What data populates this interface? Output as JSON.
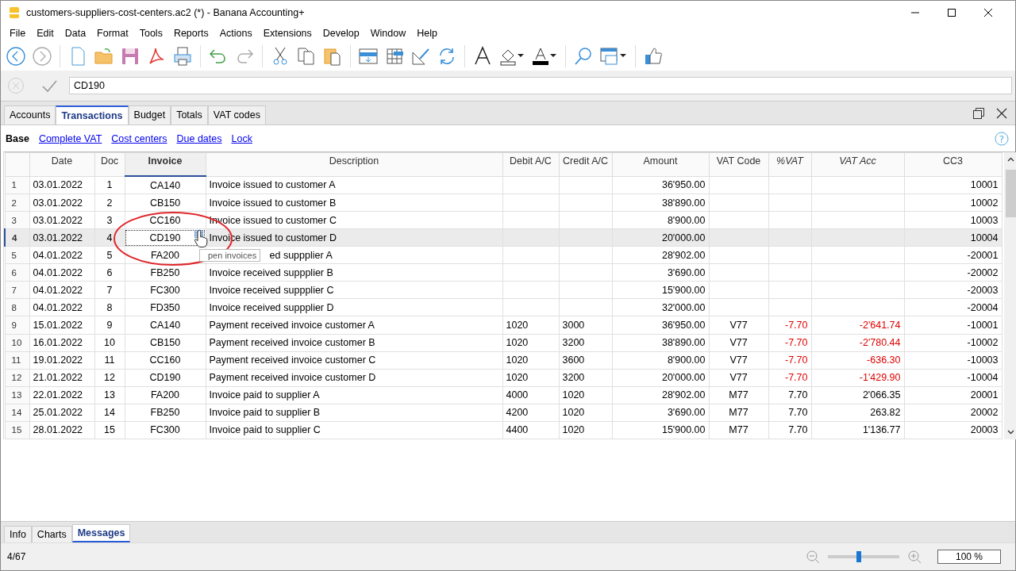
{
  "window": {
    "title": "customers-suppliers-cost-centers.ac2 (*) - Banana Accounting+"
  },
  "menu": [
    "File",
    "Edit",
    "Data",
    "Format",
    "Tools",
    "Reports",
    "Actions",
    "Extensions",
    "Develop",
    "Window",
    "Help"
  ],
  "edit_bar": {
    "value": "CD190"
  },
  "tabs": [
    {
      "label": "Accounts",
      "selected": false
    },
    {
      "label": "Transactions",
      "selected": true
    },
    {
      "label": "Budget",
      "selected": false
    },
    {
      "label": "Totals",
      "selected": false
    },
    {
      "label": "VAT codes",
      "selected": false
    }
  ],
  "views": [
    {
      "label": "Base",
      "selected": true
    },
    {
      "label": "Complete VAT",
      "selected": false
    },
    {
      "label": "Cost centers",
      "selected": false
    },
    {
      "label": "Due dates",
      "selected": false
    },
    {
      "label": "Lock",
      "selected": false
    }
  ],
  "help_button": {
    "symbol": "?"
  },
  "table": {
    "columns": [
      {
        "label": "Date",
        "selected": false
      },
      {
        "label": "Doc",
        "selected": false
      },
      {
        "label": "Invoice",
        "selected": true
      },
      {
        "label": "Description",
        "selected": false
      },
      {
        "label": "Debit A/C",
        "selected": false
      },
      {
        "label": "Credit A/C",
        "selected": false
      },
      {
        "label": "Amount",
        "selected": false
      },
      {
        "label": "VAT Code",
        "selected": false
      },
      {
        "label": "%VAT",
        "selected": false
      },
      {
        "label": "VAT Acc",
        "selected": false
      },
      {
        "label": "CC3",
        "selected": false
      }
    ],
    "rows": [
      {
        "number": "1",
        "selected": false,
        "cells": [
          "03.01.2022",
          "1",
          "CA140",
          "Invoice issued to customer A",
          "",
          "",
          "36'950.00",
          "",
          "",
          "",
          "10001"
        ]
      },
      {
        "number": "2",
        "selected": false,
        "cells": [
          "03.01.2022",
          "2",
          "CB150",
          "Invoice issued to customer B",
          "",
          "",
          "38'890.00",
          "",
          "",
          "",
          "10002"
        ]
      },
      {
        "number": "3",
        "selected": false,
        "cells": [
          "03.01.2022",
          "3",
          "CC160",
          "Invoice issued to customer C",
          "",
          "",
          "8'900.00",
          "",
          "",
          "",
          "10003"
        ]
      },
      {
        "number": "4",
        "selected": true,
        "cells": [
          "03.01.2022",
          "4",
          "CD190",
          "Invoice issued to customer D",
          "",
          "",
          "20'000.00",
          "",
          "",
          "",
          "10004"
        ]
      },
      {
        "number": "5",
        "selected": false,
        "covered": true,
        "cells": [
          "04.01.2022",
          "5",
          "FA200",
          "ed suppplier A",
          "",
          "",
          "28'902.00",
          "",
          "",
          "",
          "-20001"
        ]
      },
      {
        "number": "6",
        "selected": false,
        "cells": [
          "04.01.2022",
          "6",
          "FB250",
          "Invoice received suppplier B",
          "",
          "",
          "3'690.00",
          "",
          "",
          "",
          "-20002"
        ]
      },
      {
        "number": "7",
        "selected": false,
        "cells": [
          "04.01.2022",
          "7",
          "FC300",
          "Invoice received suppplier C",
          "",
          "",
          "15'900.00",
          "",
          "",
          "",
          "-20003"
        ]
      },
      {
        "number": "8",
        "selected": false,
        "cells": [
          "04.01.2022",
          "8",
          "FD350",
          "Invoice received suppplier D",
          "",
          "",
          "32'000.00",
          "",
          "",
          "",
          "-20004"
        ]
      },
      {
        "number": "9",
        "selected": false,
        "vat_negative": true,
        "cells": [
          "15.01.2022",
          "9",
          "CA140",
          "Payment received invoice customer A",
          "1020",
          "3000",
          "36'950.00",
          "V77",
          "-7.70",
          "-2'641.74",
          "-10001"
        ]
      },
      {
        "number": "10",
        "selected": false,
        "vat_negative": true,
        "cells": [
          "16.01.2022",
          "10",
          "CB150",
          "Payment received invoice customer B",
          "1020",
          "3200",
          "38'890.00",
          "V77",
          "-7.70",
          "-2'780.44",
          "-10002"
        ]
      },
      {
        "number": "11",
        "selected": false,
        "vat_negative": true,
        "cells": [
          "19.01.2022",
          "11",
          "CC160",
          "Payment received invoice customer C",
          "1020",
          "3600",
          "8'900.00",
          "V77",
          "-7.70",
          "-636.30",
          "-10003"
        ]
      },
      {
        "number": "12",
        "selected": false,
        "vat_negative": true,
        "cells": [
          "21.01.2022",
          "12",
          "CD190",
          "Payment received invoice customer D",
          "1020",
          "3200",
          "20'000.00",
          "V77",
          "-7.70",
          "-1'429.90",
          "-10004"
        ]
      },
      {
        "number": "13",
        "selected": false,
        "vat_negative": false,
        "cells": [
          "22.01.2022",
          "13",
          "FA200",
          "Invoice paid to supplier A",
          "4000",
          "1020",
          "28'902.00",
          "M77",
          "7.70",
          "2'066.35",
          "20001"
        ]
      },
      {
        "number": "14",
        "selected": false,
        "vat_negative": false,
        "cells": [
          "25.01.2022",
          "14",
          "FB250",
          "Invoice paid to supplier B",
          "4200",
          "1020",
          "3'690.00",
          "M77",
          "7.70",
          "263.82",
          "20002"
        ]
      },
      {
        "number": "15",
        "selected": false,
        "vat_negative": false,
        "cells": [
          "28.01.2022",
          "15",
          "FC300",
          "Invoice paid to supplier C",
          "4400",
          "1020",
          "15'900.00",
          "M77",
          "7.70",
          "1'136.77",
          "20003"
        ]
      }
    ]
  },
  "tooltip": {
    "text": "pen invoices"
  },
  "bottom_tabs": [
    {
      "label": "Info",
      "selected": false
    },
    {
      "label": "Charts",
      "selected": false
    },
    {
      "label": "Messages",
      "selected": true
    }
  ],
  "status_bar": {
    "position": "4/67",
    "zoom": "100 %",
    "zoom_slider": {
      "level": 0.43
    }
  }
}
